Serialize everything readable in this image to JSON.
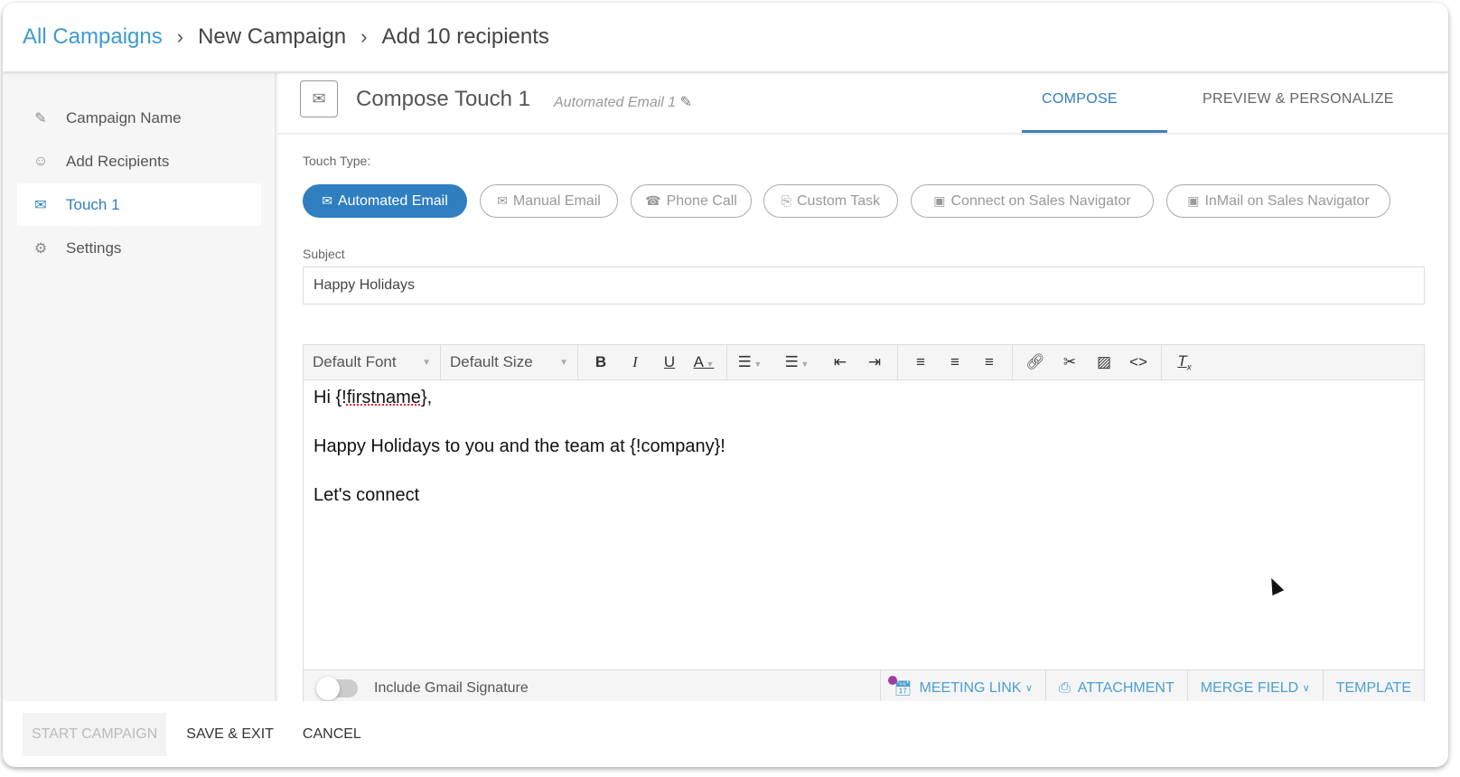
{
  "breadcrumb": [
    "All Campaigns",
    "New Campaign",
    "Add 10 recipients"
  ],
  "sidebar": {
    "items": [
      {
        "label": "Campaign Name",
        "icon": "pencil-icon"
      },
      {
        "label": "Add Recipients",
        "icon": "users-icon"
      },
      {
        "label": "Touch 1",
        "icon": "email-clock-icon",
        "active": true
      },
      {
        "label": "Settings",
        "icon": "gear-icon"
      }
    ]
  },
  "compose": {
    "title": "Compose Touch 1",
    "subtitle": "Automated Email 1",
    "tabs": [
      {
        "label": "COMPOSE",
        "active": true
      },
      {
        "label": "PREVIEW & PERSONALIZE"
      }
    ]
  },
  "touch_type": {
    "label": "Touch Type:",
    "options": [
      {
        "label": "Automated Email",
        "active": true
      },
      {
        "label": "Manual Email"
      },
      {
        "label": "Phone Call"
      },
      {
        "label": "Custom Task"
      },
      {
        "label": "Connect on Sales Navigator"
      },
      {
        "label": "InMail on Sales Navigator"
      }
    ]
  },
  "subject": {
    "label": "Subject",
    "value": "Happy Holidays"
  },
  "toolbar": {
    "font": "Default Font",
    "size": "Default Size"
  },
  "body": {
    "lines": [
      "Hi {!firstname},",
      "Happy Holidays to you and the team at {!company}!",
      "Let's connect"
    ]
  },
  "bottom": {
    "signature": "Include Gmail Signature",
    "signature_on": false,
    "meeting_link": "MEETING LINK",
    "attachment": "ATTACHMENT",
    "merge_field": "MERGE FIELD",
    "template": "TEMPLATE"
  },
  "footer": {
    "start": "START CAMPAIGN",
    "save": "SAVE & EXIT",
    "cancel": "CANCEL"
  },
  "colors": {
    "accent": "#2f7fc0",
    "link": "#3d9ad1"
  }
}
